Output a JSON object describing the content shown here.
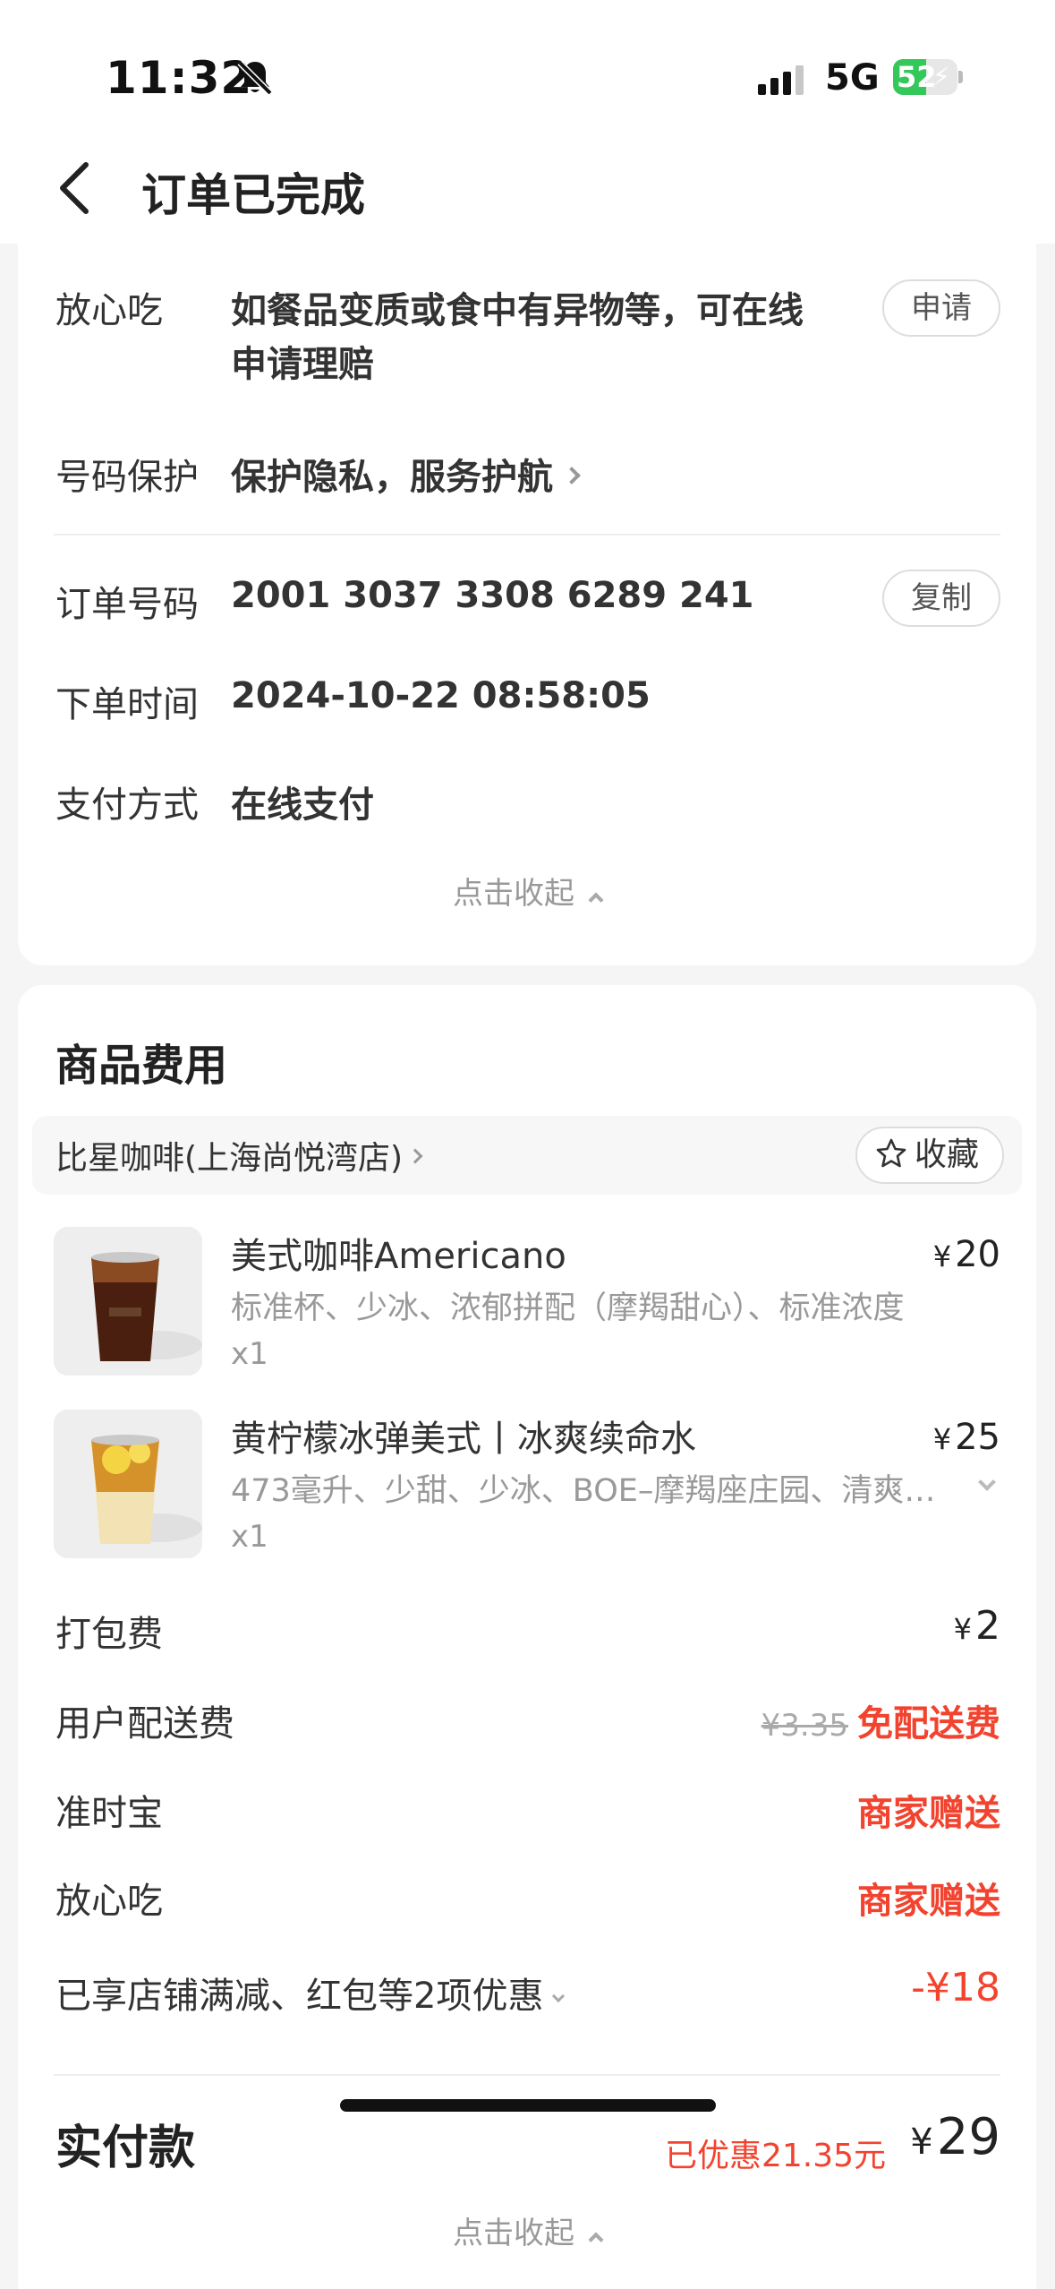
{
  "status_bar": {
    "time": "11:32",
    "network": "5G",
    "battery": "52",
    "battery_level": 0.52
  },
  "header": {
    "title": "订单已完成"
  },
  "order_info": {
    "reassure": {
      "label": "放心吃",
      "value_line1": "如餐品变质或食中有异物等，可在线",
      "value_line2": "申请理赔",
      "button": "申请"
    },
    "privacy": {
      "label": "号码保护",
      "value": "保护隐私，服务护航"
    },
    "order_no": {
      "label": "订单号码",
      "value": "2001 3037 3308 6289 241",
      "button": "复制"
    },
    "order_time": {
      "label": "下单时间",
      "value": "2024-10-22 08:58:05"
    },
    "payment": {
      "label": "支付方式",
      "value": "在线支付"
    },
    "collapse": "点击收起"
  },
  "goods": {
    "title": "商品费用",
    "store": {
      "name": "比星咖啡(上海尚悦湾店)",
      "fav": "收藏"
    },
    "items": [
      {
        "name": "美式咖啡Americano",
        "spec": "标准杯、少冰、浓郁拼配（摩羯甜心）、标准浓度",
        "qty": "x1",
        "currency": "¥",
        "price": "20"
      },
      {
        "name": "黄柠檬冰弹美式丨冰爽续命水",
        "spec": "473毫升、少甜、少冰、BOE–摩羯座庄园、清爽…",
        "qty": "x1",
        "currency": "¥",
        "price": "25"
      }
    ],
    "fees": {
      "packing": {
        "label": "打包费",
        "currency": "¥",
        "value": "2"
      },
      "delivery": {
        "label": "用户配送费",
        "original": "¥3.35",
        "value": "免配送费"
      },
      "ontime": {
        "label": "准时宝",
        "value": "商家赠送"
      },
      "reassure": {
        "label": "放心吃",
        "value": "商家赠送"
      },
      "discount": {
        "label": "已享店铺满减、红包等2项优惠",
        "value": "-¥18"
      }
    },
    "total": {
      "label": "实付款",
      "saved": "已优惠21.35元",
      "currency": "¥",
      "value": "29"
    },
    "collapse": "点击收起"
  },
  "colors": {
    "accent_red": "#f2432f",
    "battery_green": "#34c759"
  }
}
